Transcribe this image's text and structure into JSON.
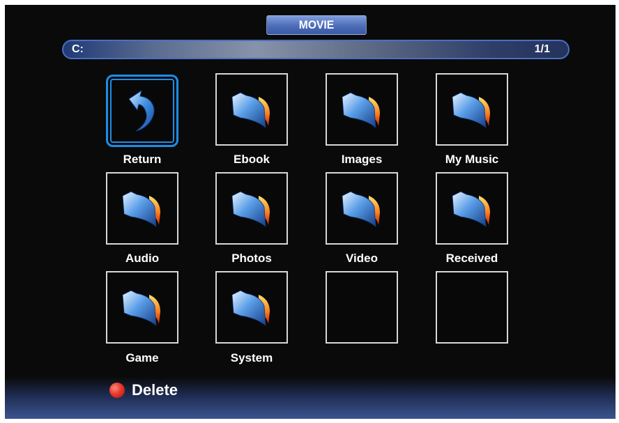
{
  "header": {
    "title": "MOVIE"
  },
  "path_bar": {
    "path": "C:",
    "page": "1/1"
  },
  "grid": {
    "items": [
      {
        "label": "Return",
        "icon": "return-arrow-icon",
        "selected": true
      },
      {
        "label": "Ebook",
        "icon": "folder-icon"
      },
      {
        "label": "Images",
        "icon": "folder-icon"
      },
      {
        "label": "My Music",
        "icon": "folder-icon"
      },
      {
        "label": "Audio",
        "icon": "folder-icon"
      },
      {
        "label": "Photos",
        "icon": "folder-icon"
      },
      {
        "label": "Video",
        "icon": "folder-icon"
      },
      {
        "label": "Received",
        "icon": "folder-icon"
      },
      {
        "label": "Game",
        "icon": "folder-icon"
      },
      {
        "label": "System",
        "icon": "folder-icon"
      },
      {
        "label": "",
        "icon": ""
      },
      {
        "label": "",
        "icon": ""
      }
    ]
  },
  "footer": {
    "delete_label": "Delete",
    "delete_key_color": "#e8382b"
  },
  "colors": {
    "selection": "#1c8ee8",
    "title_tab": "#4d6db8",
    "background": "#0a0a0a"
  }
}
